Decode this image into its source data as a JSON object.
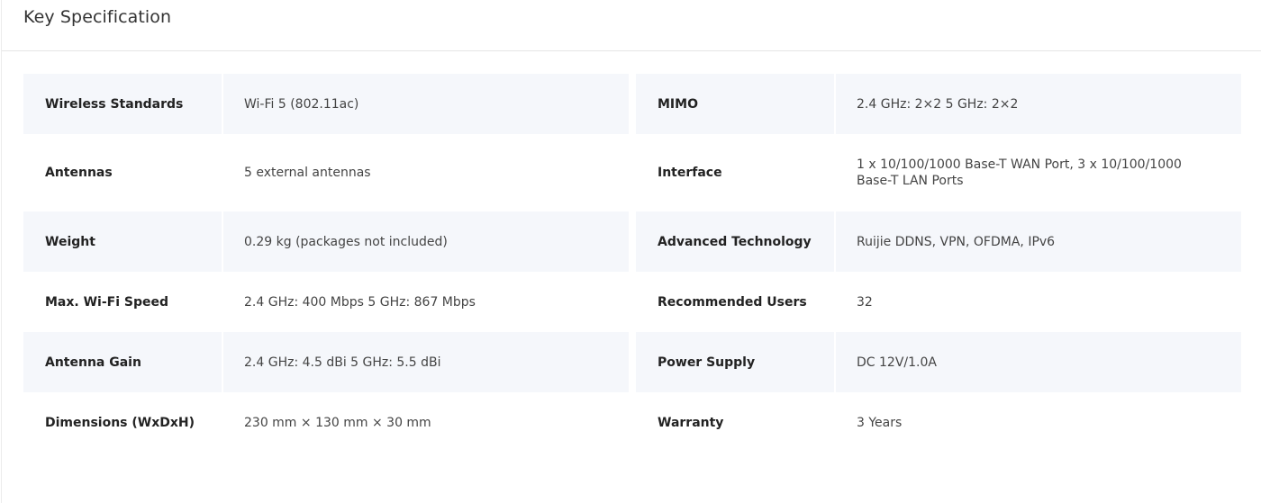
{
  "section": {
    "title": "Key Specification"
  },
  "specs": [
    {
      "left": {
        "label": "Wireless Standards",
        "value": "Wi-Fi 5 (802.11ac)"
      },
      "right": {
        "label": "MIMO",
        "value": "2.4 GHz: 2×2 5 GHz: 2×2"
      }
    },
    {
      "left": {
        "label": "Antennas",
        "value": "5 external antennas"
      },
      "right": {
        "label": "Interface",
        "value": "1 x 10/100/1000 Base-T WAN Port, 3 x 10/100/1000 Base-T LAN Ports"
      }
    },
    {
      "left": {
        "label": "Weight",
        "value": "0.29 kg (packages not included)"
      },
      "right": {
        "label": "Advanced Technology",
        "value": "Ruijie DDNS, VPN, OFDMA, IPv6"
      }
    },
    {
      "left": {
        "label": "Max. Wi-Fi Speed",
        "value": "2.4 GHz: 400 Mbps 5 GHz: 867 Mbps"
      },
      "right": {
        "label": "Recommended Users",
        "value": "32"
      }
    },
    {
      "left": {
        "label": "Antenna Gain",
        "value": "2.4 GHz: 4.5 dBi 5 GHz: 5.5 dBi"
      },
      "right": {
        "label": "Power Supply",
        "value": "DC 12V/1.0A"
      }
    },
    {
      "left": {
        "label": "Dimensions (WxDxH)",
        "value": "230 mm × 130 mm × 30 mm"
      },
      "right": {
        "label": "Warranty",
        "value": "3 Years"
      }
    }
  ],
  "colors": {
    "shaded_row": "#f5f7fb",
    "border": "#e6e6e6",
    "label_text": "#222222",
    "value_text": "#444444"
  }
}
